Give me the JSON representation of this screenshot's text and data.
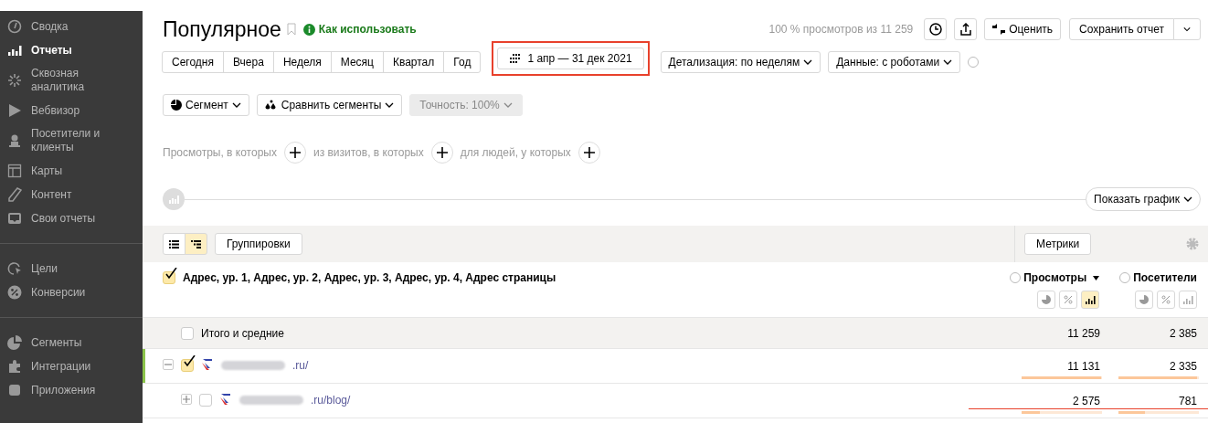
{
  "sidebar": {
    "groups": [
      {
        "items": [
          {
            "label": "Сводка",
            "selected": false
          },
          {
            "label": "Отчеты",
            "selected": true
          },
          {
            "label": "Сквозная аналитика",
            "selected": false
          },
          {
            "label": "Вебвизор",
            "selected": false
          },
          {
            "label": "Посетители и клиенты",
            "selected": false
          },
          {
            "label": "Карты",
            "selected": false
          },
          {
            "label": "Контент",
            "selected": false
          },
          {
            "label": "Свои отчеты",
            "selected": false
          }
        ]
      },
      {
        "items": [
          {
            "label": "Цели",
            "selected": false
          },
          {
            "label": "Конверсии",
            "selected": false
          }
        ]
      },
      {
        "items": [
          {
            "label": "Сегменты",
            "selected": false
          },
          {
            "label": "Интеграции",
            "selected": false
          },
          {
            "label": "Приложения",
            "selected": false
          }
        ]
      }
    ]
  },
  "header": {
    "title": "Популярное",
    "help_link": "Как использовать",
    "sample_info": "100 % просмотров из 11 259",
    "rate_button": "Оценить",
    "save_button": "Сохранить отчет"
  },
  "periods": [
    {
      "label": "Сегодня",
      "selected": false
    },
    {
      "label": "Вчера",
      "selected": false
    },
    {
      "label": "Неделя",
      "selected": false
    },
    {
      "label": "Месяц",
      "selected": false
    },
    {
      "label": "Квартал",
      "selected": false
    },
    {
      "label": "Год",
      "selected": false
    }
  ],
  "date_range": {
    "label": "1 апр — 31 дек 2021",
    "highlighted": true
  },
  "dropdowns": [
    {
      "label": "Детализация: по неделям"
    },
    {
      "label": "Данные: с роботами"
    }
  ],
  "segment_controls": [
    {
      "label": "Сегмент",
      "disabled": false
    },
    {
      "label": "Сравнить сегменты",
      "disabled": false
    },
    {
      "label": "Точность: 100%",
      "disabled": true
    }
  ],
  "filters": [
    "Просмотры, в которых",
    "из визитов, в которых",
    "для людей, у которых"
  ],
  "chart_toggle": "Показать график",
  "table": {
    "view_modes": [
      {
        "selected": false
      },
      {
        "selected": true
      }
    ],
    "groupings_button": "Группировки",
    "metrics_button": "Метрики",
    "dimension": {
      "label": "Адрес, ур. 1, Адрес, ур. 2, Адрес, ур. 3, Адрес, ур. 4, Адрес страницы",
      "checked": true
    },
    "columns": [
      {
        "label": "Просмотры",
        "sorted": true,
        "modes": [
          {
            "selected": false
          },
          {
            "selected": false
          },
          {
            "selected": true
          }
        ]
      },
      {
        "label": "Посетители",
        "sorted": false,
        "modes": [
          {
            "selected": false
          },
          {
            "selected": false
          },
          {
            "selected": false
          }
        ]
      }
    ],
    "totals": {
      "label": "Итого и средние",
      "checked": false,
      "values": [
        "11 259",
        "2 385"
      ]
    },
    "rows": [
      {
        "label": ".ru/",
        "checked": true,
        "expanded": true,
        "underlined": false,
        "values": [
          {
            "text": "11 131",
            "level": 0.99
          },
          {
            "text": "2 335",
            "level": 0.98
          }
        ],
        "children": [
          {
            "label": ".ru/blog/",
            "checked": false,
            "expanded": false,
            "underlined": true,
            "values": [
              {
                "text": "2 575",
                "level": 0.23
              },
              {
                "text": "781",
                "level": 0.33
              }
            ]
          }
        ]
      }
    ]
  }
}
